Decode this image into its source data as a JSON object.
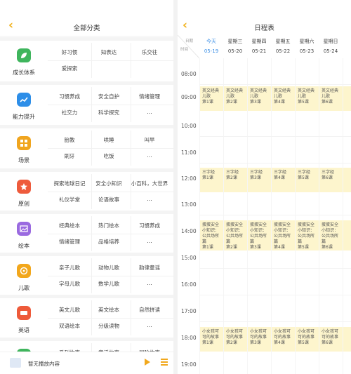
{
  "left": {
    "title": "全部分类",
    "categories": [
      {
        "name": "成长体系",
        "color": "#3fb55d",
        "icon": "leaf-icon",
        "items": [
          "好习惯",
          "知表达",
          "乐交往",
          "爱探索",
          "",
          ""
        ]
      },
      {
        "name": "能力提升",
        "color": "#2d8ee8",
        "icon": "chart-icon",
        "items": [
          "习惯养成",
          "安全自护",
          "情绪管理",
          "社交力",
          "科学探究",
          "..."
        ]
      },
      {
        "name": "场景",
        "color": "#f0a51f",
        "icon": "grid-icon",
        "items": [
          "胎教",
          "哄睡",
          "叫早",
          "刷牙",
          "吃饭",
          "..."
        ]
      },
      {
        "name": "原创",
        "color": "#ee5b3c",
        "icon": "star-icon",
        "items": [
          "探索地球日记",
          "安全小知识",
          "小百科，大世界",
          "礼仪学堂",
          "论语故事",
          "..."
        ]
      },
      {
        "name": "绘本",
        "color": "#9a6ae0",
        "icon": "picture-icon",
        "items": [
          "经典绘本",
          "热门绘本",
          "习惯养成",
          "情绪管理",
          "品格培养",
          "..."
        ]
      },
      {
        "name": "儿歌",
        "color": "#f2a71c",
        "icon": "music-icon",
        "items": [
          "亲子儿歌",
          "动物儿歌",
          "韵律童谣",
          "字母儿歌",
          "数学儿歌",
          "..."
        ]
      },
      {
        "name": "英语",
        "color": "#ee5a3a",
        "icon": "abc-icon",
        "items": [
          "英文儿歌",
          "英文绘本",
          "自然拼读",
          "双语绘本",
          "分级读物",
          "..."
        ]
      },
      {
        "name": "",
        "color": "#3fb55d",
        "icon": "book-icon",
        "items": [
          "系列故事",
          "童话故事",
          "冒险故事",
          "",
          "",
          ""
        ]
      }
    ],
    "player": {
      "text": "暂无播放内容"
    }
  },
  "right": {
    "title": "日程表",
    "corner": {
      "date_label": "日期",
      "time_label": "时间"
    },
    "days": [
      {
        "week": "今天",
        "date": "05-19",
        "today": true
      },
      {
        "week": "星期三",
        "date": "05-20",
        "today": false
      },
      {
        "week": "星期四",
        "date": "05-21",
        "today": false
      },
      {
        "week": "星期五",
        "date": "05-22",
        "today": false
      },
      {
        "week": "星期六",
        "date": "05-23",
        "today": false
      },
      {
        "week": "星期日",
        "date": "05-24",
        "today": false
      }
    ],
    "hours": [
      "08:00",
      "09:00",
      "10:00",
      "11:00",
      "12:00",
      "13:00",
      "14:00",
      "15:00",
      "16:00",
      "17:00",
      "18:00",
      "19:00"
    ],
    "event_rows": [
      {
        "hour": "09:00",
        "title": "英文经典儿歌",
        "lessons": [
          "第1课",
          "第2课",
          "第3课",
          "第4课",
          "第5课",
          "第6课"
        ]
      },
      {
        "hour": "12:00",
        "title": "三字经",
        "lessons": [
          "第1课",
          "第2课",
          "第3课",
          "第4课",
          "第5课",
          "第6课"
        ]
      },
      {
        "hour": "14:00",
        "title": "蛋蛋安全小知识：公共场所篇",
        "lessons": [
          "第1课",
          "第2课",
          "第3课",
          "第4课",
          "第5课",
          "第6课"
        ]
      },
      {
        "hour": "18:00",
        "title": "小女孩可可的故事",
        "lessons": [
          "第1课",
          "第2课",
          "第3课",
          "第4课",
          "第5课",
          "第6课"
        ]
      }
    ]
  }
}
